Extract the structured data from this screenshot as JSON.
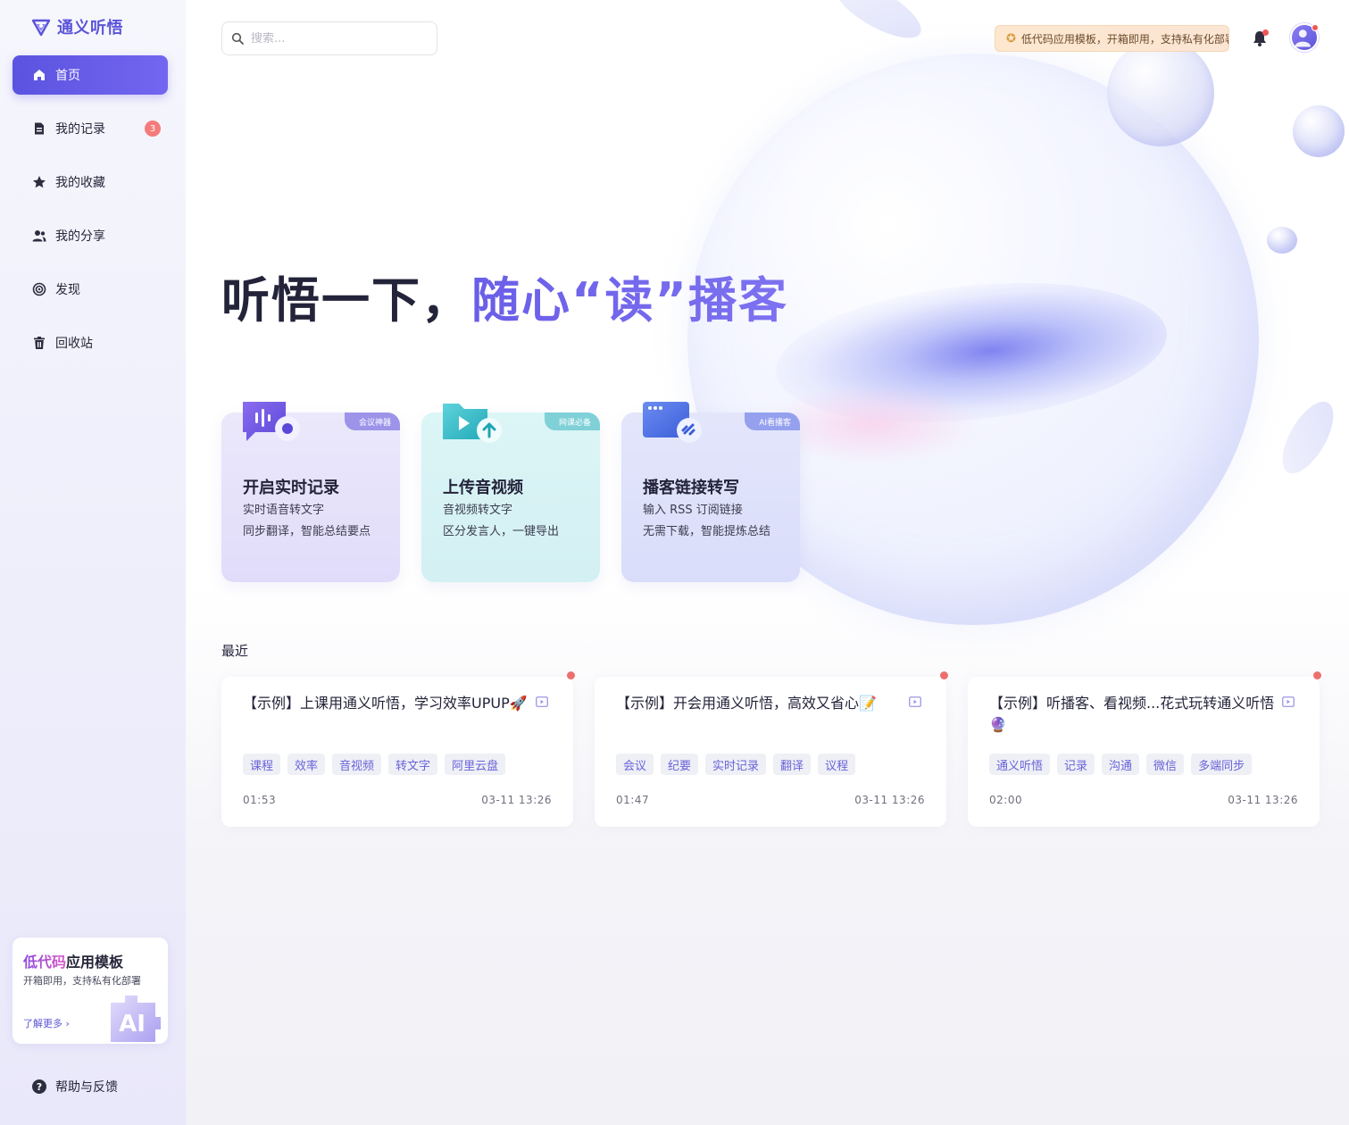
{
  "app": {
    "name": "通义听悟",
    "brand_color": "#5b54d8"
  },
  "sidebar": {
    "items": [
      {
        "label": "首页",
        "icon": "home-icon",
        "active": true
      },
      {
        "label": "我的记录",
        "icon": "document-icon",
        "badge": "3"
      },
      {
        "label": "我的收藏",
        "icon": "star-icon"
      },
      {
        "label": "我的分享",
        "icon": "users-icon"
      },
      {
        "label": "发现",
        "icon": "discover-icon"
      },
      {
        "label": "回收站",
        "icon": "trash-icon"
      }
    ],
    "promo": {
      "title_highlight": "低代码",
      "title_rest": "应用模板",
      "subtitle": "开箱即用，支持私有化部署",
      "link": "了解更多 ›",
      "image_text": "AI"
    },
    "help": {
      "label": "帮助与反馈",
      "icon": "help-icon"
    }
  },
  "header": {
    "search_placeholder": "搜索...",
    "notice": "低代码应用模板，开箱即用，支持私有化部署",
    "bell_icon": "bell-icon",
    "avatar_icon": "user-avatar-icon"
  },
  "hero": {
    "prefix": "听悟一下，",
    "accent": "随心“读”播客"
  },
  "feature_cards": [
    {
      "tag": "会议神器",
      "title": "开启实时记录",
      "line1": "实时语音转文字",
      "line2": "同步翻译，智能总结要点",
      "icon": "microphone-chat-icon"
    },
    {
      "tag": "网课必备",
      "title": "上传音视频",
      "line1": "音视频转文字",
      "line2": "区分发言人，一键导出",
      "icon": "upload-video-icon"
    },
    {
      "tag": "AI看播客",
      "title": "播客链接转写",
      "line1": "输入 RSS 订阅链接",
      "line2": "无需下载，智能提炼总结",
      "icon": "link-window-icon"
    }
  ],
  "recent": {
    "title": "最近",
    "items": [
      {
        "title": "【示例】上课用通义听悟，学习效率UPUP🚀",
        "tags": [
          "课程",
          "效率",
          "音视频",
          "转文字",
          "阿里云盘"
        ],
        "duration": "01:53",
        "date": "03-11 13:26"
      },
      {
        "title": "【示例】开会用通义听悟，高效又省心📝",
        "tags": [
          "会议",
          "纪要",
          "实时记录",
          "翻译",
          "议程"
        ],
        "duration": "01:47",
        "date": "03-11 13:26"
      },
      {
        "title": "【示例】听播客、看视频...花式玩转通义听悟🔮",
        "tags": [
          "通义听悟",
          "记录",
          "沟通",
          "微信",
          "多端同步"
        ],
        "duration": "02:00",
        "date": "03-11 13:26"
      }
    ]
  }
}
